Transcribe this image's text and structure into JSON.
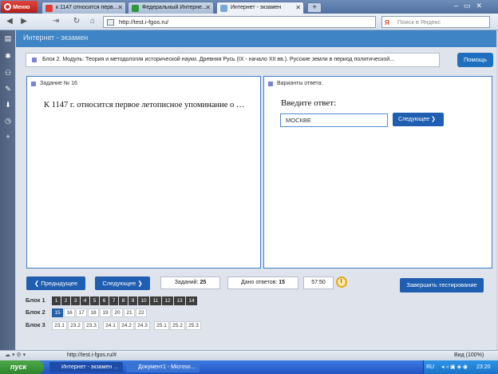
{
  "browser": {
    "menu_label": "Меню",
    "tabs": [
      {
        "label": "к 1147 относится перв...",
        "active": false
      },
      {
        "label": "Федеральный Интерне...",
        "active": false
      },
      {
        "label": "Интернет - экзамен",
        "active": true
      }
    ],
    "new_tab": "+",
    "window_controls": "–▭✕",
    "url": "http://test.i-fgos.ru/",
    "search_placeholder": "Поиск в Яндекс",
    "search_engine_letter": "Я"
  },
  "page": {
    "header_title": "Интернет - экзамен",
    "block_info": "Блок 2. Модуль: Теория и методология исторической науки. Древняя Русь (IX - начало XII вв.). Русские земли в период политической...",
    "help_label": "Помощь",
    "question_panel": {
      "heading": "Задание № 16",
      "text": "К 1147 г. относится первое летописное упоминание о …"
    },
    "answer_panel": {
      "heading": "Варианты ответа:",
      "prompt": "Введите ответ:",
      "answer_value": "МОСКВЕ",
      "next_label": "Следующее ❯"
    },
    "nav": {
      "prev_label": "❮ Предыдущее",
      "next_label": "Следующее ❯",
      "tasks_label": "Заданий:",
      "tasks_count": "25",
      "answered_label": "Дано ответов:",
      "answered_count": "15",
      "timer": "57:50",
      "finish_label": "Завершить тестирование"
    },
    "blocks": [
      {
        "label": "Блок 1",
        "cells": [
          "1",
          "2",
          "3",
          "4",
          "5",
          "6",
          "7",
          "8",
          "9",
          "10",
          "11",
          "12",
          "13",
          "14"
        ]
      },
      {
        "label": "Блок 2",
        "cells": [
          "15",
          "16",
          "17",
          "18",
          "19",
          "20",
          "21",
          "22"
        ]
      },
      {
        "label": "Блок 3",
        "cells": [
          "23.1",
          "23.2",
          "23.3",
          "24.1",
          "24.2",
          "24.3",
          "25.1",
          "25.2",
          "25.3"
        ]
      }
    ]
  },
  "statusbar": {
    "url": "http://test.i-fgos.ru/#",
    "zoom": "Вид (100%)"
  },
  "taskbar": {
    "start_label": "пуск",
    "tasks": [
      "Интернет - экзамен ...",
      "Документ1 - Microso..."
    ],
    "lang": "RU",
    "time": "23:20"
  },
  "colors": {
    "header_blue": "#3f84c4",
    "button_blue": "#1f5eb0",
    "panel_border": "#3f7fc0",
    "answered_cell": "#3d3d3d"
  }
}
